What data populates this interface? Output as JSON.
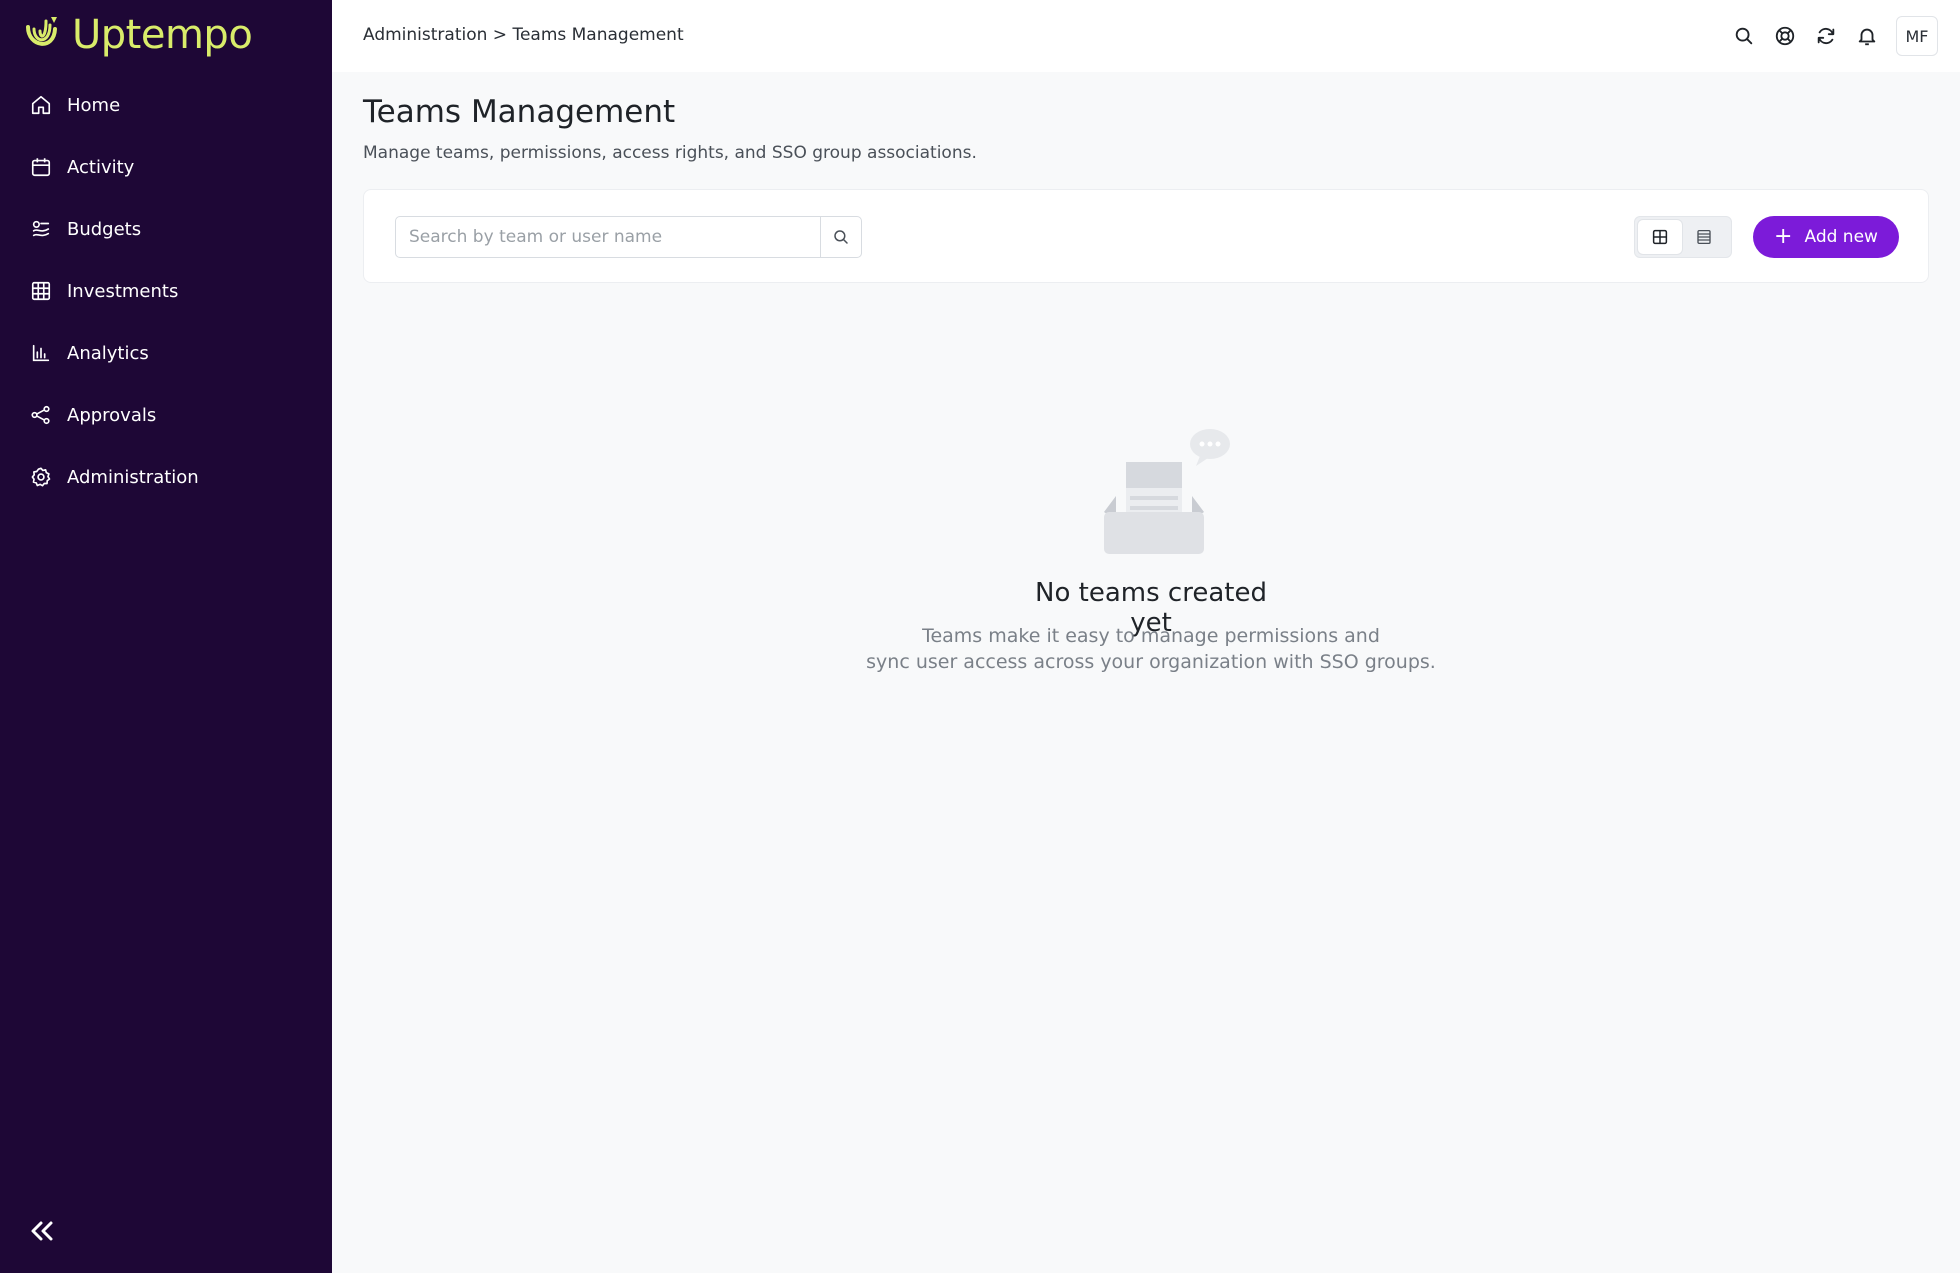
{
  "brand": {
    "name": "Uptempo",
    "accent": "#d9ec6a",
    "sidebar_bg": "#1e0736",
    "primary": "#7c1bd9"
  },
  "sidebar": {
    "items": [
      {
        "label": "Home",
        "icon": "home-icon"
      },
      {
        "label": "Activity",
        "icon": "calendar-icon"
      },
      {
        "label": "Budgets",
        "icon": "budgets-icon"
      },
      {
        "label": "Investments",
        "icon": "table-grid-icon"
      },
      {
        "label": "Analytics",
        "icon": "bar-chart-icon"
      },
      {
        "label": "Approvals",
        "icon": "share-nodes-icon"
      },
      {
        "label": "Administration",
        "icon": "gear-icon"
      }
    ],
    "collapse_icon": "double-chevron-left-icon"
  },
  "header": {
    "breadcrumb": "Administration > Teams Management",
    "icons": [
      "search-icon",
      "help-lifebuoy-icon",
      "refresh-icon",
      "bell-icon"
    ],
    "avatar_initials": "MF"
  },
  "main": {
    "title": "Teams Management",
    "subtitle": "Manage teams, permissions, access rights, and SSO group associations.",
    "search": {
      "placeholder": "Search by team or user name",
      "value": ""
    },
    "view_toggle": {
      "options": [
        "grid-view-icon",
        "list-view-icon"
      ],
      "selected": "grid-view-icon"
    },
    "add_button_label": "Add new",
    "empty_state": {
      "title": "No teams created yet",
      "text_line1": "Teams make it easy to manage permissions and",
      "text_line2": "sync user access across your organization with SSO groups."
    }
  }
}
